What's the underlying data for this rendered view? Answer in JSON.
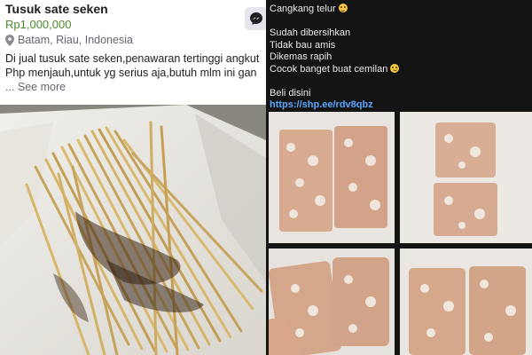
{
  "listing": {
    "title": "Tusuk sate seken",
    "price": "Rp1,000,000",
    "location": "Batam, Riau, Indonesia",
    "description": "Di jual tusuk sate seken,penawaran tertinggi angkut Php menjauh,untuk yg serius aja,butuh mlm ini gan",
    "see_more": "... See more",
    "message_icon": "messenger-icon",
    "location_icon": "map-pin-icon"
  },
  "post": {
    "line1": "Cangkang telur",
    "line2": "Sudah dibersihkan",
    "line3": "Tidak bau amis",
    "line4": "Dikemas rapih",
    "line5": "Cocok banget buat cemilan",
    "line6": "Beli disini",
    "link": "https://shp.ee/rdv8qbz"
  },
  "colors": {
    "price": "#4a8a2a",
    "link": "#5aa7ff",
    "dark_bg": "#141414"
  }
}
